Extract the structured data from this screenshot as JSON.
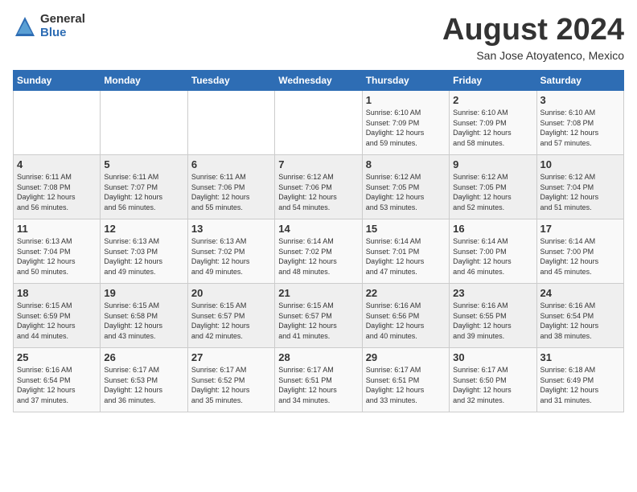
{
  "logo": {
    "general": "General",
    "blue": "Blue"
  },
  "title": "August 2024",
  "location": "San Jose Atoyatenco, Mexico",
  "days_of_week": [
    "Sunday",
    "Monday",
    "Tuesday",
    "Wednesday",
    "Thursday",
    "Friday",
    "Saturday"
  ],
  "weeks": [
    [
      {
        "day": "",
        "info": ""
      },
      {
        "day": "",
        "info": ""
      },
      {
        "day": "",
        "info": ""
      },
      {
        "day": "",
        "info": ""
      },
      {
        "day": "1",
        "info": "Sunrise: 6:10 AM\nSunset: 7:09 PM\nDaylight: 12 hours\nand 59 minutes."
      },
      {
        "day": "2",
        "info": "Sunrise: 6:10 AM\nSunset: 7:09 PM\nDaylight: 12 hours\nand 58 minutes."
      },
      {
        "day": "3",
        "info": "Sunrise: 6:10 AM\nSunset: 7:08 PM\nDaylight: 12 hours\nand 57 minutes."
      }
    ],
    [
      {
        "day": "4",
        "info": "Sunrise: 6:11 AM\nSunset: 7:08 PM\nDaylight: 12 hours\nand 56 minutes."
      },
      {
        "day": "5",
        "info": "Sunrise: 6:11 AM\nSunset: 7:07 PM\nDaylight: 12 hours\nand 56 minutes."
      },
      {
        "day": "6",
        "info": "Sunrise: 6:11 AM\nSunset: 7:06 PM\nDaylight: 12 hours\nand 55 minutes."
      },
      {
        "day": "7",
        "info": "Sunrise: 6:12 AM\nSunset: 7:06 PM\nDaylight: 12 hours\nand 54 minutes."
      },
      {
        "day": "8",
        "info": "Sunrise: 6:12 AM\nSunset: 7:05 PM\nDaylight: 12 hours\nand 53 minutes."
      },
      {
        "day": "9",
        "info": "Sunrise: 6:12 AM\nSunset: 7:05 PM\nDaylight: 12 hours\nand 52 minutes."
      },
      {
        "day": "10",
        "info": "Sunrise: 6:12 AM\nSunset: 7:04 PM\nDaylight: 12 hours\nand 51 minutes."
      }
    ],
    [
      {
        "day": "11",
        "info": "Sunrise: 6:13 AM\nSunset: 7:04 PM\nDaylight: 12 hours\nand 50 minutes."
      },
      {
        "day": "12",
        "info": "Sunrise: 6:13 AM\nSunset: 7:03 PM\nDaylight: 12 hours\nand 49 minutes."
      },
      {
        "day": "13",
        "info": "Sunrise: 6:13 AM\nSunset: 7:02 PM\nDaylight: 12 hours\nand 49 minutes."
      },
      {
        "day": "14",
        "info": "Sunrise: 6:14 AM\nSunset: 7:02 PM\nDaylight: 12 hours\nand 48 minutes."
      },
      {
        "day": "15",
        "info": "Sunrise: 6:14 AM\nSunset: 7:01 PM\nDaylight: 12 hours\nand 47 minutes."
      },
      {
        "day": "16",
        "info": "Sunrise: 6:14 AM\nSunset: 7:00 PM\nDaylight: 12 hours\nand 46 minutes."
      },
      {
        "day": "17",
        "info": "Sunrise: 6:14 AM\nSunset: 7:00 PM\nDaylight: 12 hours\nand 45 minutes."
      }
    ],
    [
      {
        "day": "18",
        "info": "Sunrise: 6:15 AM\nSunset: 6:59 PM\nDaylight: 12 hours\nand 44 minutes."
      },
      {
        "day": "19",
        "info": "Sunrise: 6:15 AM\nSunset: 6:58 PM\nDaylight: 12 hours\nand 43 minutes."
      },
      {
        "day": "20",
        "info": "Sunrise: 6:15 AM\nSunset: 6:57 PM\nDaylight: 12 hours\nand 42 minutes."
      },
      {
        "day": "21",
        "info": "Sunrise: 6:15 AM\nSunset: 6:57 PM\nDaylight: 12 hours\nand 41 minutes."
      },
      {
        "day": "22",
        "info": "Sunrise: 6:16 AM\nSunset: 6:56 PM\nDaylight: 12 hours\nand 40 minutes."
      },
      {
        "day": "23",
        "info": "Sunrise: 6:16 AM\nSunset: 6:55 PM\nDaylight: 12 hours\nand 39 minutes."
      },
      {
        "day": "24",
        "info": "Sunrise: 6:16 AM\nSunset: 6:54 PM\nDaylight: 12 hours\nand 38 minutes."
      }
    ],
    [
      {
        "day": "25",
        "info": "Sunrise: 6:16 AM\nSunset: 6:54 PM\nDaylight: 12 hours\nand 37 minutes."
      },
      {
        "day": "26",
        "info": "Sunrise: 6:17 AM\nSunset: 6:53 PM\nDaylight: 12 hours\nand 36 minutes."
      },
      {
        "day": "27",
        "info": "Sunrise: 6:17 AM\nSunset: 6:52 PM\nDaylight: 12 hours\nand 35 minutes."
      },
      {
        "day": "28",
        "info": "Sunrise: 6:17 AM\nSunset: 6:51 PM\nDaylight: 12 hours\nand 34 minutes."
      },
      {
        "day": "29",
        "info": "Sunrise: 6:17 AM\nSunset: 6:51 PM\nDaylight: 12 hours\nand 33 minutes."
      },
      {
        "day": "30",
        "info": "Sunrise: 6:17 AM\nSunset: 6:50 PM\nDaylight: 12 hours\nand 32 minutes."
      },
      {
        "day": "31",
        "info": "Sunrise: 6:18 AM\nSunset: 6:49 PM\nDaylight: 12 hours\nand 31 minutes."
      }
    ]
  ]
}
